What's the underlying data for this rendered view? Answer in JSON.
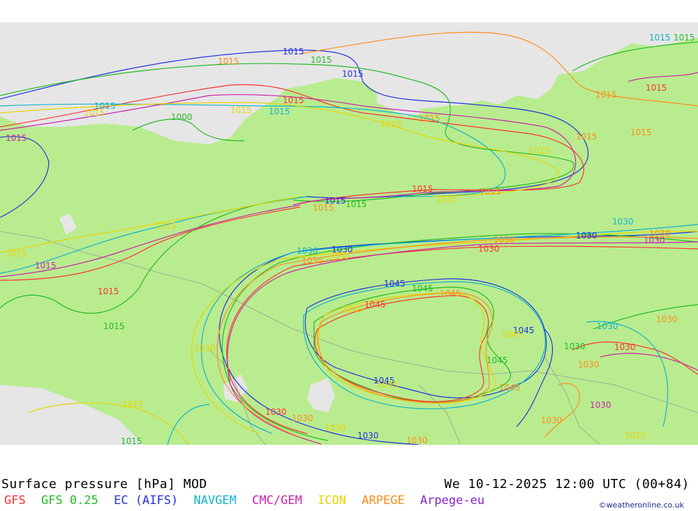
{
  "title": "Surface pressure [hPa] MOD",
  "datetime": "We 10-12-2025 12:00 UTC (00+84)",
  "credit": "©weatheronline.co.uk",
  "legend": [
    {
      "label": "GFS",
      "color": "#ff3030"
    },
    {
      "label": "GFS 0.25",
      "color": "#22bb22"
    },
    {
      "label": "EC (AIFS)",
      "color": "#2233dd"
    },
    {
      "label": "NAVGEM",
      "color": "#11b3cc"
    },
    {
      "label": "CMC/GEM",
      "color": "#cc22aa"
    },
    {
      "label": "ICON",
      "color": "#e8d400"
    },
    {
      "label": "ARPEGE",
      "color": "#ff8c1a"
    },
    {
      "label": "Arpege-eu",
      "color": "#8822cc"
    }
  ],
  "colors": {
    "land": "#b9ec8f",
    "sea": "#e6e6e6",
    "border": "#9a9a9a"
  },
  "isobar_labels": {
    "l1015": "1015",
    "l1000": "1000",
    "l1030": "1030",
    "l1045": "1045"
  }
}
